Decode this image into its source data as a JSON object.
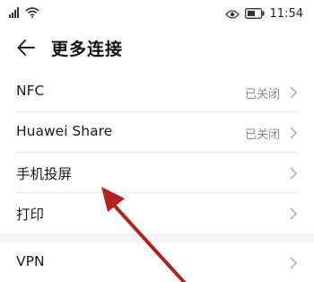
{
  "status_bar": {
    "time": "11:54",
    "icons": [
      "signal-icon",
      "wifi-icon",
      "eye-comfort-icon",
      "battery-icon"
    ]
  },
  "header": {
    "back_icon": "back-arrow-icon",
    "title": "更多连接"
  },
  "list": {
    "items": [
      {
        "label": "NFC",
        "value": "已关闭"
      },
      {
        "label": "Huawei Share",
        "value": "已关闭"
      },
      {
        "label": "手机投屏",
        "value": ""
      },
      {
        "label": "打印",
        "value": ""
      },
      {
        "label": "VPN",
        "value": ""
      }
    ]
  },
  "colors": {
    "background": "#ffffff",
    "text": "#1a1a1a",
    "secondary_text": "#8a8a8a",
    "divider": "#e8e8e8",
    "annotation_arrow": "#b22222"
  }
}
